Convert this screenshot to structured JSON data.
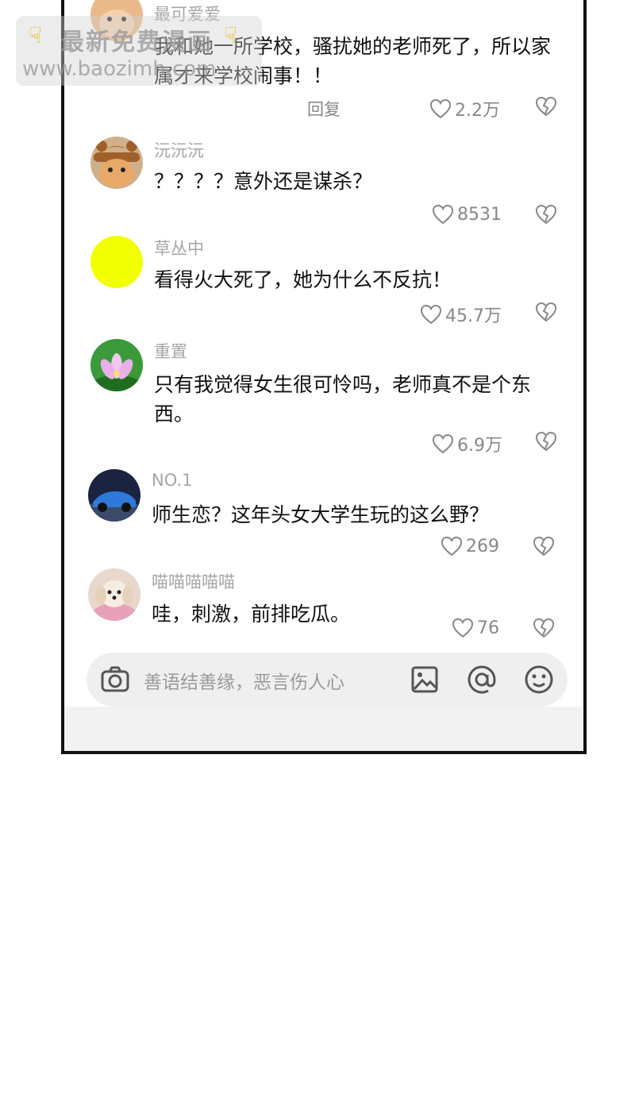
{
  "watermark": {
    "line1": "最新免费漫画",
    "line2": "www.baozimh.com",
    "icon": "pointing-hand-icon"
  },
  "comments": [
    {
      "username": "最可爱爱",
      "text": "我和她一所学校，骚扰她的老师死了，所以家属才来学校闹事！！",
      "reply": "回复",
      "likes": "2.2万",
      "avatar": "hamster-avatar"
    },
    {
      "username": "沅沅沅",
      "text": "？？？？意外还是谋杀？",
      "likes": "8531",
      "avatar": "cat-in-bear-hat-avatar"
    },
    {
      "username": "草丛中",
      "text": "看得火大死了，她为什么不反抗！",
      "likes": "45.7万",
      "avatar": "yellow-circle-avatar",
      "avatar_color": "#f2ff00"
    },
    {
      "username": "重置",
      "text": "只有我觉得女生很可怜吗，老师真不是个东西。",
      "likes": "6.9万",
      "avatar": "lotus-avatar"
    },
    {
      "username": "NO.1",
      "text": "师生恋？这年头女大学生玩的这么野？",
      "likes": "269",
      "avatar": "sports-car-avatar"
    },
    {
      "username": "喵喵喵喵喵",
      "text": "哇，刺激，前排吃瓜。",
      "likes": "76",
      "avatar": "puppy-avatar"
    }
  ],
  "input": {
    "placeholder": "善语结善缘，恶言伤人心"
  },
  "colors": {
    "frame": "#111111",
    "muted": "#a6a6a6",
    "input_bg": "#efefef"
  }
}
